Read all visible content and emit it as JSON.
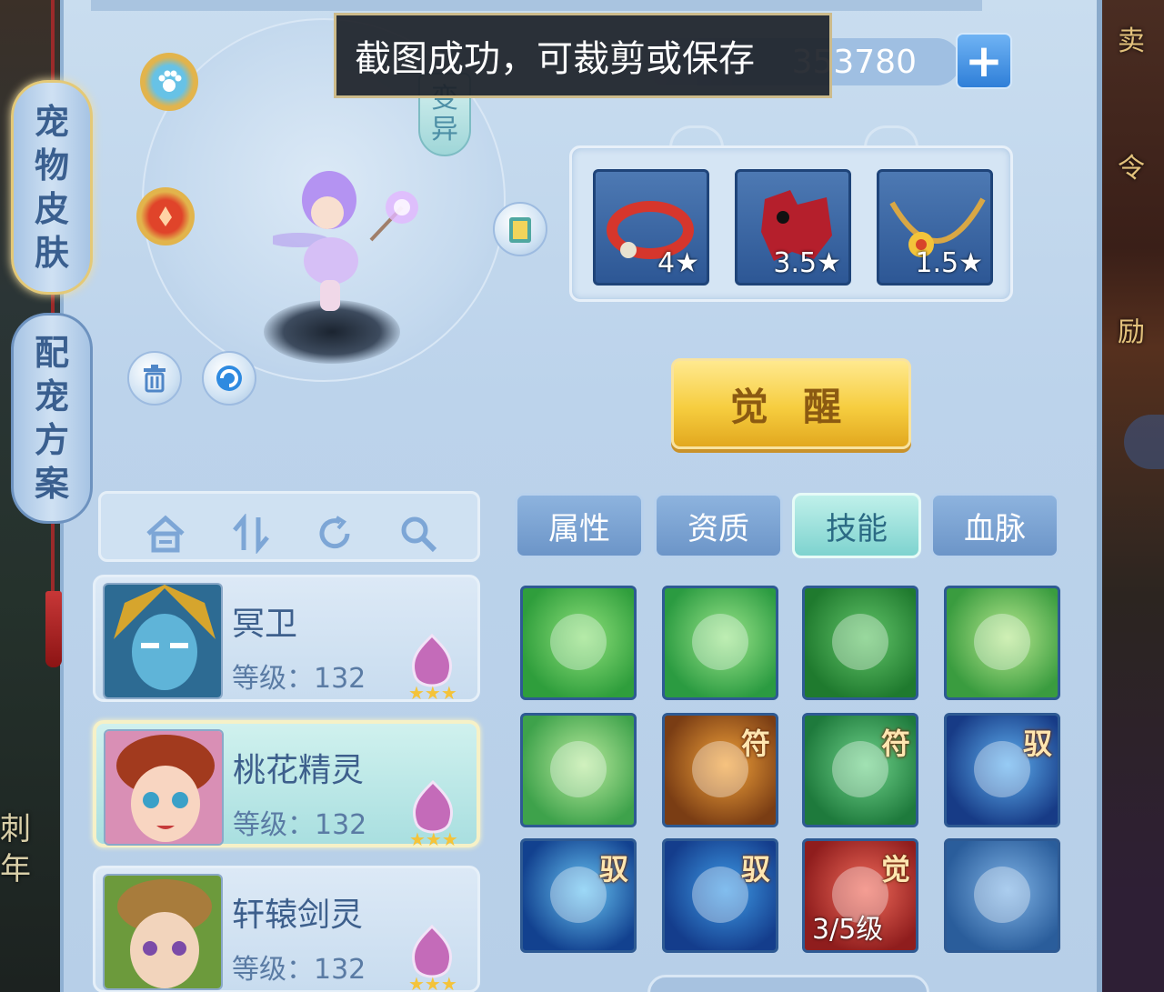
{
  "toast": {
    "text": "截图成功，可裁剪或保存"
  },
  "currency": {
    "amount": "353780",
    "add_label": "+"
  },
  "side_tabs": [
    {
      "label": [
        "宠",
        "物",
        "皮",
        "肤"
      ],
      "active": true
    },
    {
      "label": [
        "配",
        "宠",
        "方",
        "案"
      ],
      "active": false
    }
  ],
  "right_side_text": [
    "卖",
    "令",
    "励"
  ],
  "left_bg_text": [
    "刺",
    "年"
  ],
  "stage": {
    "bian_yi": [
      "变",
      "异"
    ]
  },
  "equipment": [
    {
      "name": "ring",
      "stars": "4★"
    },
    {
      "name": "armor",
      "stars": "3.5★"
    },
    {
      "name": "necklace",
      "stars": "1.5★"
    }
  ],
  "awaken_label": "觉 醒",
  "attr_tabs": [
    {
      "label": "属性",
      "active": false
    },
    {
      "label": "资质",
      "active": false
    },
    {
      "label": "技能",
      "active": true
    },
    {
      "label": "血脉",
      "active": false
    }
  ],
  "pets": [
    {
      "name": "冥卫",
      "level": "等级：132",
      "selected": false
    },
    {
      "name": "桃花精灵",
      "level": "等级：132",
      "selected": true
    },
    {
      "name": "轩辕剑灵",
      "level": "等级：132",
      "selected": false
    }
  ],
  "skills": [
    {
      "icon": "wings-icon",
      "tag": "",
      "level": "",
      "colors": [
        "#2f9e3c",
        "#8ee07a"
      ]
    },
    {
      "icon": "heart-wings-icon",
      "tag": "",
      "level": "",
      "colors": [
        "#2b9b41",
        "#9be58a"
      ]
    },
    {
      "icon": "lizard-icon",
      "tag": "",
      "level": "",
      "colors": [
        "#1f7a2e",
        "#63c56a"
      ]
    },
    {
      "icon": "fire-palm-icon",
      "tag": "",
      "level": "",
      "colors": [
        "#3a9c3f",
        "#b7e88e"
      ]
    },
    {
      "icon": "water-palm-icon",
      "tag": "",
      "level": "",
      "colors": [
        "#3ea24b",
        "#b8ea9c"
      ]
    },
    {
      "icon": "figure-glow-icon",
      "tag": "符",
      "level": "",
      "colors": [
        "#7a3d14",
        "#f2a23a"
      ]
    },
    {
      "icon": "shield-swirl-icon",
      "tag": "符",
      "level": "",
      "colors": [
        "#1e7a3c",
        "#6fd28a"
      ]
    },
    {
      "icon": "figure-burst-icon",
      "tag": "驭",
      "level": "",
      "colors": [
        "#173b86",
        "#5fb0f0"
      ]
    },
    {
      "icon": "shield-blue-icon",
      "tag": "驭",
      "level": "",
      "colors": [
        "#12418f",
        "#68c4f3"
      ]
    },
    {
      "icon": "swirl-shield-icon",
      "tag": "驭",
      "level": "",
      "colors": [
        "#143d8c",
        "#3f9be6"
      ]
    },
    {
      "icon": "fire-demon-icon",
      "tag": "觉",
      "level": "3/5级",
      "colors": [
        "#8f1d1d",
        "#f06a5a"
      ]
    },
    {
      "icon": "skill-book-icon",
      "tag": "",
      "level": "",
      "colors": [
        "#2a5d9b",
        "#7fb3e6"
      ]
    }
  ],
  "colors": {
    "accent": "#f6cd3f",
    "panel": "#c9ddef",
    "tab_active": "#7ed3cf"
  }
}
